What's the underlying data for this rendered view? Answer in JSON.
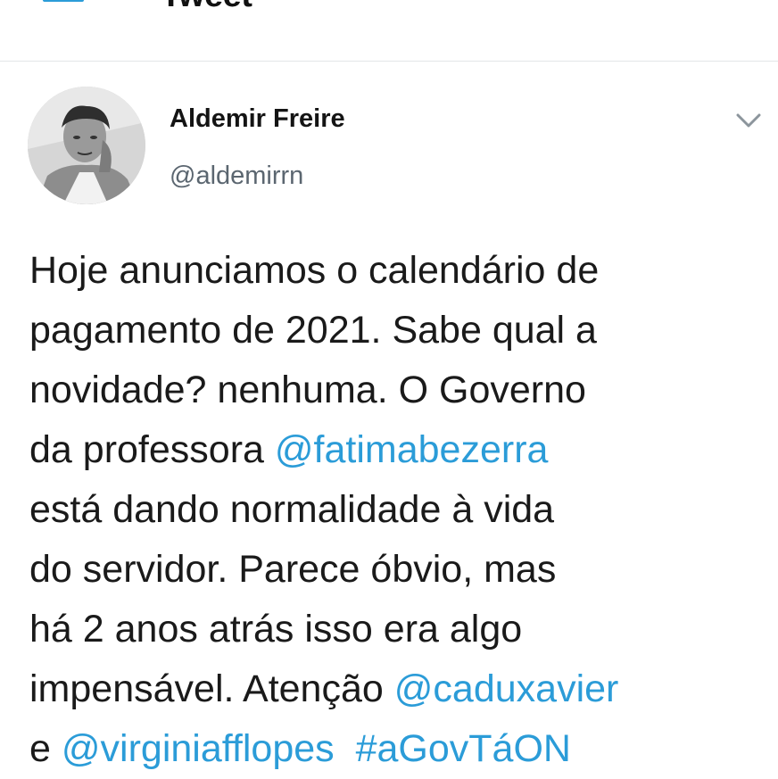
{
  "header": {
    "title": "Tweet",
    "back_icon": "arrow-left-icon",
    "accent_color": "#2b9cd8"
  },
  "tweet": {
    "author": {
      "name": "Aldemir Freire",
      "handle": "@aldemirrn",
      "avatar_icon": "user-avatar"
    },
    "menu_icon": "chevron-down-icon",
    "lines": [
      {
        "text": "Hoje anunciamos o calendário de"
      },
      {
        "text": "pagamento de 2021. Sabe qual a"
      },
      {
        "text": "novidade? nenhuma. O Governo"
      },
      {
        "pre": "da professora ",
        "mention": "@fatimabezerra"
      },
      {
        "text": "está dando normalidade à vida"
      },
      {
        "text": "do servidor. Parece óbvio, mas"
      },
      {
        "text": "há 2 anos atrás isso era algo"
      },
      {
        "pre": "impensável. Atenção ",
        "mention": "@caduxavier"
      },
      {
        "pre": "e ",
        "mention": "@virginiafflopes",
        "gap": "  ",
        "hashtag": "#aGovTáON"
      }
    ]
  }
}
